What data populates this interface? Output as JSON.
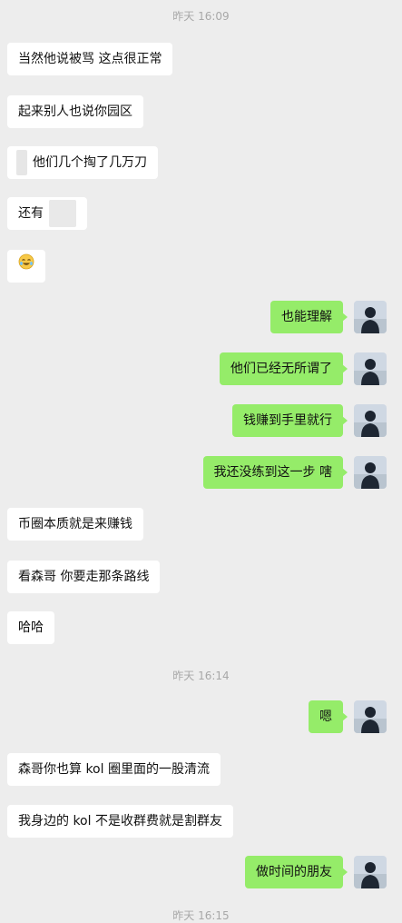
{
  "conversation": {
    "timestamps": [
      "昨天 16:09",
      "昨天 16:14",
      "昨天 16:15"
    ],
    "messages": [
      {
        "side": "left",
        "text": "当然他说被骂 这点很正常"
      },
      {
        "side": "left",
        "text": "起来别人也说你园区"
      },
      {
        "side": "left",
        "text": "他们几个掏了几万刀"
      },
      {
        "side": "left",
        "text": "还有"
      },
      {
        "side": "left",
        "text": "",
        "emoji": "laughing-crying-emoji"
      },
      {
        "side": "right",
        "text": "也能理解"
      },
      {
        "side": "right",
        "text": "他们已经无所谓了"
      },
      {
        "side": "right",
        "text": "钱赚到手里就行"
      },
      {
        "side": "right",
        "text": "我还没练到这一步 嗐"
      },
      {
        "side": "left",
        "text": "币圈本质就是来赚钱"
      },
      {
        "side": "left",
        "text": "看森哥 你要走那条路线"
      },
      {
        "side": "left",
        "text": "哈哈"
      },
      {
        "side": "right",
        "text": "嗯"
      },
      {
        "side": "left",
        "text": "森哥你也算 kol 圈里面的一股清流"
      },
      {
        "side": "left",
        "text": "我身边的 kol 不是收群费就是割群友"
      },
      {
        "side": "right",
        "text": "做时间的朋友"
      }
    ]
  },
  "colors": {
    "background": "#ededed",
    "bubble_left": "#ffffff",
    "bubble_right": "#95ec69",
    "timestamp_text": "#a8a8a8"
  }
}
